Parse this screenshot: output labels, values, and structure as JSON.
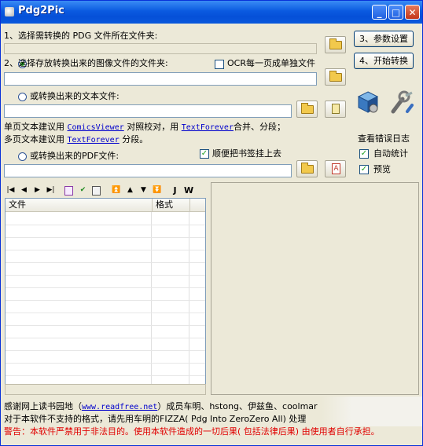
{
  "window": {
    "title": "Pdg2Pic",
    "minimize_glyph": "_",
    "maximize_glyph": "□",
    "close_glyph": "✕"
  },
  "step1": {
    "label": "1、选择需转换的 PDG 文件所在文件夹:"
  },
  "buttons": {
    "settings": "3、参数设置",
    "convert": "4、开始转换"
  },
  "step2": {
    "image_label": "2、选择存放转换出来的图像文件的文件夹:",
    "ocr_label": "OCR每一页成单独文件",
    "text_label": "或转换出来的文本文件:",
    "pdf_label": "或转换出来的PDF文件:",
    "bookmark_label": "顺便把书签挂上去"
  },
  "notes": {
    "line1_prefix": "单页文本建议用",
    "line1_link1": "ComicsViewer",
    "line1_mid": "对照校对，用",
    "line1_link2": "TextForever",
    "line1_suffix": "合并、分段；",
    "line2_prefix": "多页文本建议用",
    "line2_link": "TextForever",
    "line2_suffix": "分段。"
  },
  "log": {
    "title": "查看错误日志",
    "auto_stats": "自动统计",
    "preview": "预览"
  },
  "toolbar": {
    "icons": [
      "first-icon",
      "prev-icon",
      "next-icon",
      "last-icon",
      "page-icon",
      "check-icon",
      "copy-icon",
      "top-icon",
      "up-icon",
      "down-icon",
      "bottom-icon",
      "j-icon",
      "w-icon"
    ],
    "j": "J",
    "w": "W"
  },
  "filelist": {
    "columns": [
      "文件",
      "格式"
    ]
  },
  "footer": {
    "thanks_prefix": "感谢网上读书园地（",
    "thanks_link": "www.readfree.net",
    "thanks_suffix": "）成员车明、hstong、伊兹鱼、coolmar",
    "unsupported": "对于本软件不支持的格式，请先用车明的FIZZA( Pdg Into ZeroZero All) 处理",
    "warning": "警告：本软件严禁用于非法目的。使用本软件造成的一切后果( 包括法律后果) 由使用者自行承担。"
  },
  "colors": {
    "title_bar": "#0a5ae0",
    "link": "#0000cc",
    "warning": "#e00000",
    "face": "#ece9d8"
  }
}
